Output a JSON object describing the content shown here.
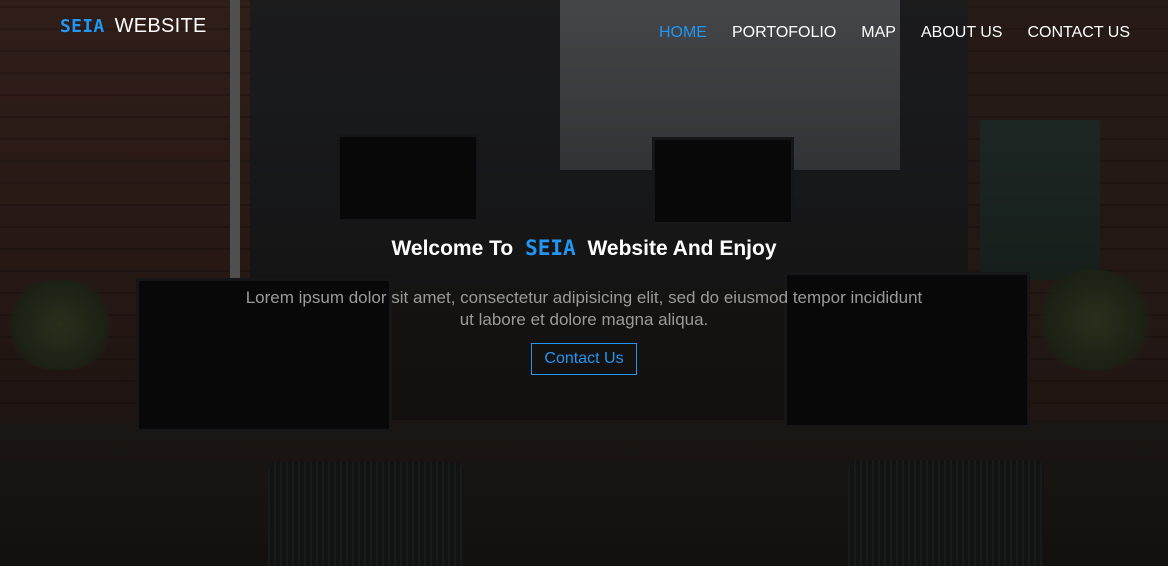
{
  "brand": {
    "accent": "SEIA",
    "name": "WEBSITE"
  },
  "nav": {
    "items": [
      {
        "label": "HOME",
        "active": true
      },
      {
        "label": "PORTOFOLIO",
        "active": false
      },
      {
        "label": "MAP",
        "active": false
      },
      {
        "label": "ABOUT US",
        "active": false
      },
      {
        "label": "CONTACT US",
        "active": false
      }
    ]
  },
  "hero": {
    "headline_prefix": "Welcome To",
    "headline_accent": "SEIA",
    "headline_suffix": "Website And Enjoy",
    "lead": "Lorem ipsum dolor sit amet, consectetur adipisicing elit, sed do eiusmod tempor incididunt ut labore et dolore magna aliqua.",
    "cta_label": "Contact Us"
  },
  "colors": {
    "accent": "#2196f3",
    "text": "#ffffff",
    "muted": "#9a9a9a"
  }
}
